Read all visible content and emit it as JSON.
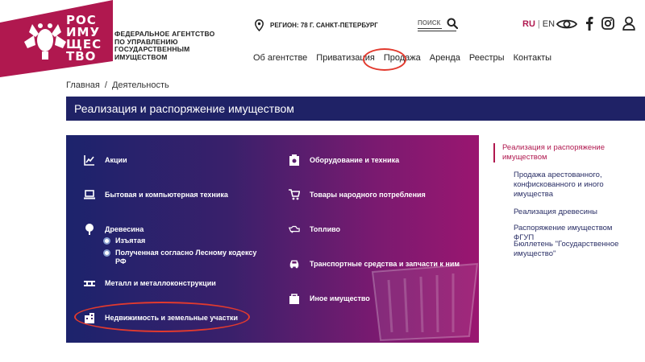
{
  "logo": {
    "word_lines": [
      "РОС",
      "ИМУ",
      "ЩЕС",
      "ТВО"
    ],
    "agency_lines": [
      "Федеральное агентство",
      "по управлению",
      "государственным",
      "имуществом"
    ],
    "brand_color": "#b0184f"
  },
  "topbar": {
    "region_label": "Регион: 78 г. Санкт-Петербург",
    "search_placeholder": "ПОИСК",
    "lang_ru": "RU",
    "lang_sep": "|",
    "lang_en": "EN",
    "icons": [
      "location-pin-icon",
      "search-icon",
      "eye-icon",
      "facebook-icon",
      "instagram-icon",
      "user-icon"
    ]
  },
  "nav": {
    "items": [
      "Об агентстве",
      "Приватизация",
      "Продажа",
      "Аренда",
      "Реестры",
      "Контакты"
    ]
  },
  "breadcrumb": {
    "home": "Главная",
    "sep": "/",
    "current": "Деятельность"
  },
  "page_title": "Реализация и распоряжение имуществом",
  "categories": {
    "left": [
      {
        "label": "Акции",
        "icon": "chart-icon"
      },
      {
        "label": "Бытовая и компьютерная техника",
        "icon": "laptop-icon"
      },
      {
        "label": "Древесина",
        "icon": "tree-icon"
      },
      {
        "label": "Металл и металлоконструкции",
        "icon": "beam-icon"
      },
      {
        "label": "Недвижимость и земельные участки",
        "icon": "building-icon"
      }
    ],
    "wood_sub": [
      "Изъятая",
      "Полученная согласно Лесному кодексу РФ"
    ],
    "right": [
      {
        "label": "Оборудование и техника",
        "icon": "equipment-icon"
      },
      {
        "label": "Товары народного потребления",
        "icon": "cart-icon"
      },
      {
        "label": "Топливо",
        "icon": "fuel-icon"
      },
      {
        "label": "Транспортные средства и запчасти к ним",
        "icon": "car-icon"
      },
      {
        "label": "Иное имущество",
        "icon": "bag-icon"
      }
    ]
  },
  "side_menu": {
    "active": "Реализация и распоряжение имуществом",
    "items": [
      "Продажа арестованного, конфискованного и иного имущества",
      "Реализация древесины",
      "Распоряжение имуществом ФГУП",
      "Бюллетень \"Государственное имущество\""
    ]
  },
  "colors": {
    "title_bar": "#1f2266",
    "accent": "#b0184f",
    "annotation": "#e23a2e"
  }
}
